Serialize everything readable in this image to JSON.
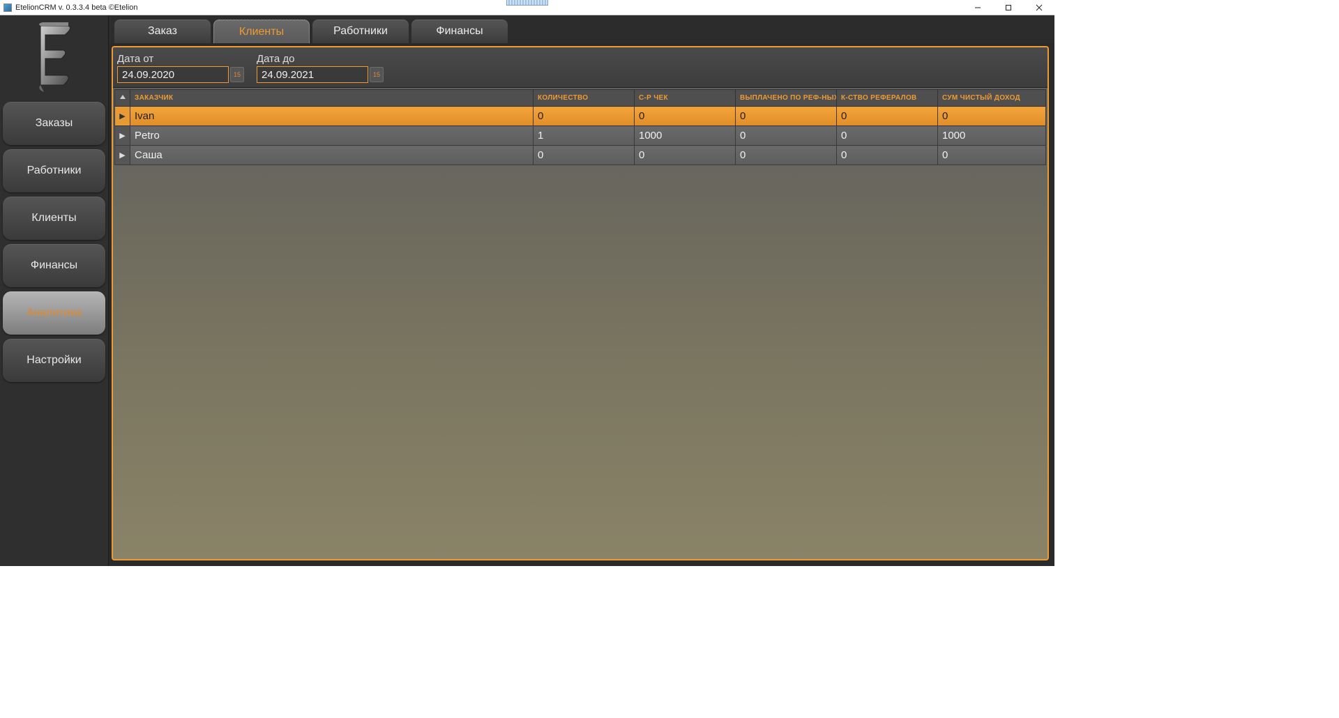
{
  "window": {
    "title": "EtelionCRM v. 0.3.3.4 beta ©Etelion"
  },
  "sidebar": {
    "items": [
      {
        "label": "Заказы"
      },
      {
        "label": "Работники"
      },
      {
        "label": "Клиенты"
      },
      {
        "label": "Финансы"
      },
      {
        "label": "Аналитика"
      },
      {
        "label": "Настройки"
      }
    ],
    "active_index": 4
  },
  "tabs": {
    "items": [
      {
        "label": "Заказ"
      },
      {
        "label": "Клиенты"
      },
      {
        "label": "Работники"
      },
      {
        "label": "Финансы"
      }
    ],
    "active_index": 1
  },
  "filters": {
    "from_label": "Дата от",
    "to_label": "Дата до",
    "from_value": "24.09.2020",
    "to_value": "24.09.2021",
    "cal_glyph": "15"
  },
  "table": {
    "columns": {
      "customer": "ЗАКАЗЧИК",
      "qty": "КОЛИЧЕСТВО",
      "avg": "С-Р ЧЕК",
      "refpay": "ВЫПЛАЧЕНО ПО РЕФ-НЫХ",
      "refcnt": "К-СТВО РЕФЕРАЛОВ",
      "net": "СУМ ЧИСТЫЙ ДОХОД"
    },
    "rows": [
      {
        "customer": "Ivan",
        "qty": "0",
        "avg": "0",
        "refpay": "0",
        "refcnt": "0",
        "net": "0"
      },
      {
        "customer": "Petro",
        "qty": "1",
        "avg": "1000",
        "refpay": "0",
        "refcnt": "0",
        "net": "1000"
      },
      {
        "customer": "Саша",
        "qty": "0",
        "avg": "0",
        "refpay": "0",
        "refcnt": "0",
        "net": "0"
      }
    ],
    "selected_index": 0
  }
}
